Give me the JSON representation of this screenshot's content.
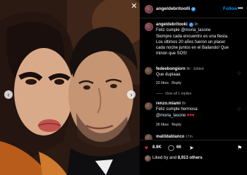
{
  "post": {
    "username": "angeldebritoolli",
    "follow_label": "Follow",
    "more_label": "•••"
  },
  "caption": {
    "username": "angeldebritooki",
    "time": "9h",
    "line1_pre": "Feliz cumple ",
    "line1_mention": "@moria_lasone",
    "line2": "Siempre cada encuentro es una fiesta.",
    "line3": "Los últimos 20 años fueron un placer",
    "line4": "cada noche  juntos en el Bailando! Que",
    "line5": "minon que SOS!"
  },
  "comments": [
    {
      "username": "fedeebongiorn",
      "time": "8h · Edited",
      "text": "Que dupiaaa",
      "likes": "23 likes",
      "reply": "Reply",
      "view_replies": "View all 1 replies"
    },
    {
      "username": "renzo.miami",
      "time": "8h",
      "text_pre": "Feliz cumple hermosa",
      "text_mention": "@moria_lasone",
      "text_hearts": "♥♥♥",
      "likes": "26 likes",
      "reply": "Reply"
    },
    {
      "username": "matildablanco",
      "time": "17m"
    }
  ],
  "actions": {
    "like_count": "8.9K",
    "comment_count": "66",
    "liked_by_prefix": "Liked by ",
    "liked_by_bold1": "",
    "liked_by_and": "and ",
    "liked_by_bold2": "8,913 others"
  },
  "colors": {
    "link": "#0095f6",
    "verified": "#3897f0",
    "heart": "#ff3040"
  },
  "icons": [
    "chevron-left-icon",
    "chevron-right-icon",
    "close-icon",
    "verified-icon",
    "heart-icon",
    "comment-icon",
    "share-icon",
    "bookmark-icon"
  ]
}
